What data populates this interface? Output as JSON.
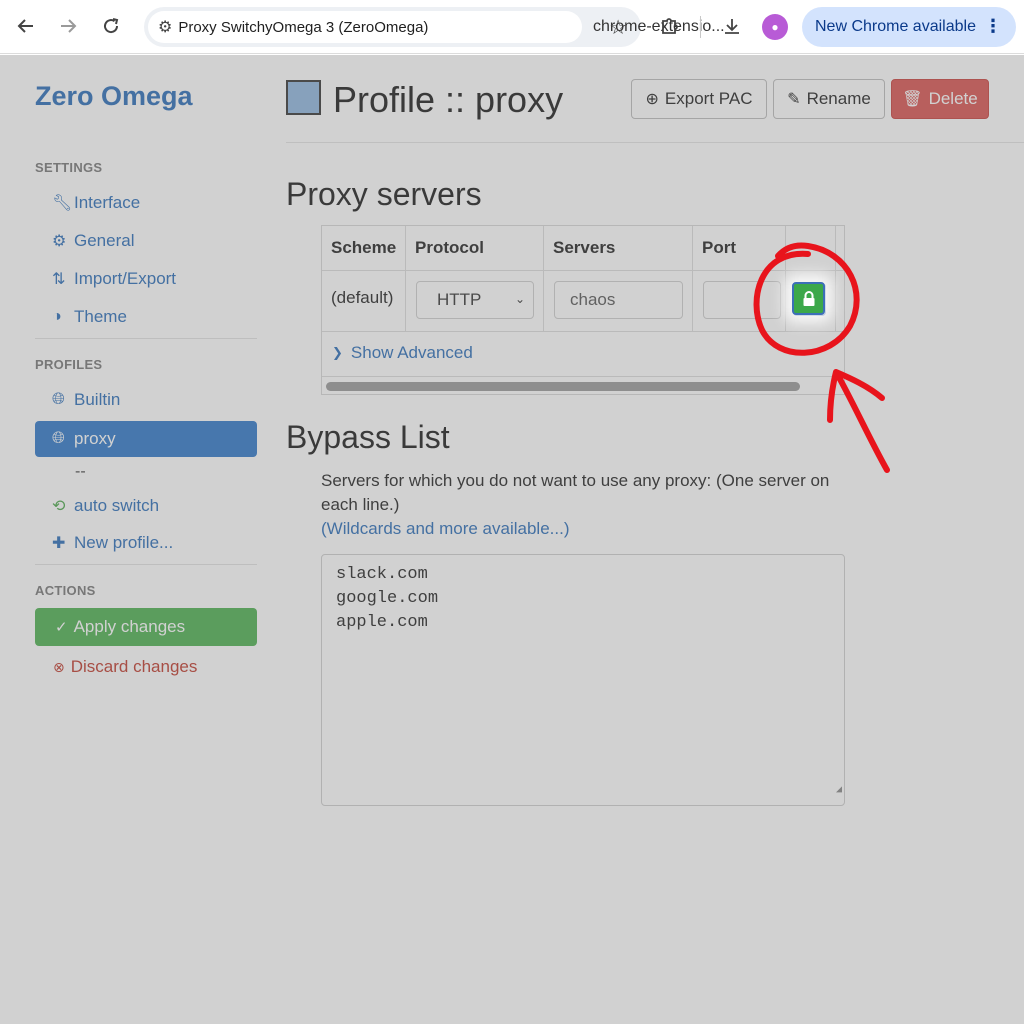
{
  "browser": {
    "tab_title": "Proxy SwitchyOmega 3 (ZeroOmega)",
    "url": "chrome-extensio...",
    "update_label": "New Chrome available"
  },
  "sidebar": {
    "brand": "Zero Omega",
    "settings_header": "SETTINGS",
    "settings_items": [
      {
        "label": "Interface",
        "icon": "wrench-icon"
      },
      {
        "label": "General",
        "icon": "gear-icon"
      },
      {
        "label": "Import/Export",
        "icon": "import-export-icon"
      },
      {
        "label": "Theme",
        "icon": "half-circle-icon"
      }
    ],
    "profiles_header": "PROFILES",
    "profile_items": [
      {
        "label": "Builtin",
        "icon": "globe-icon"
      },
      {
        "label": "proxy",
        "icon": "globe-icon",
        "active": true
      },
      {
        "label": "auto switch",
        "icon": "retweet-icon"
      },
      {
        "label": "New profile...",
        "icon": "plus-icon"
      }
    ],
    "dash_text": "--",
    "actions_header": "ACTIONS",
    "apply_label": "Apply changes",
    "discard_label": "Discard changes"
  },
  "header": {
    "title": "Profile :: proxy",
    "profile_color": "#8fb7e0",
    "export_label": "Export PAC",
    "rename_label": "Rename",
    "delete_label": "Delete"
  },
  "proxy_servers": {
    "heading": "Proxy servers",
    "columns": [
      "Scheme",
      "Protocol",
      "Servers",
      "Port"
    ],
    "row": {
      "scheme": "(default)",
      "protocol": "HTTP",
      "server": "chaos",
      "port": ""
    },
    "show_advanced": "Show Advanced"
  },
  "bypass": {
    "heading": "Bypass List",
    "description": "Servers for which you do not want to use any proxy: (One server on each line.)",
    "wildcards_link": "(Wildcards and more available...)",
    "lines": [
      "slack.com",
      "google.com",
      "apple.com"
    ]
  },
  "colors": {
    "accent": "#2a6db8",
    "apply": "#4cb050",
    "danger": "#d9534f",
    "annotation": "#e8141c"
  }
}
